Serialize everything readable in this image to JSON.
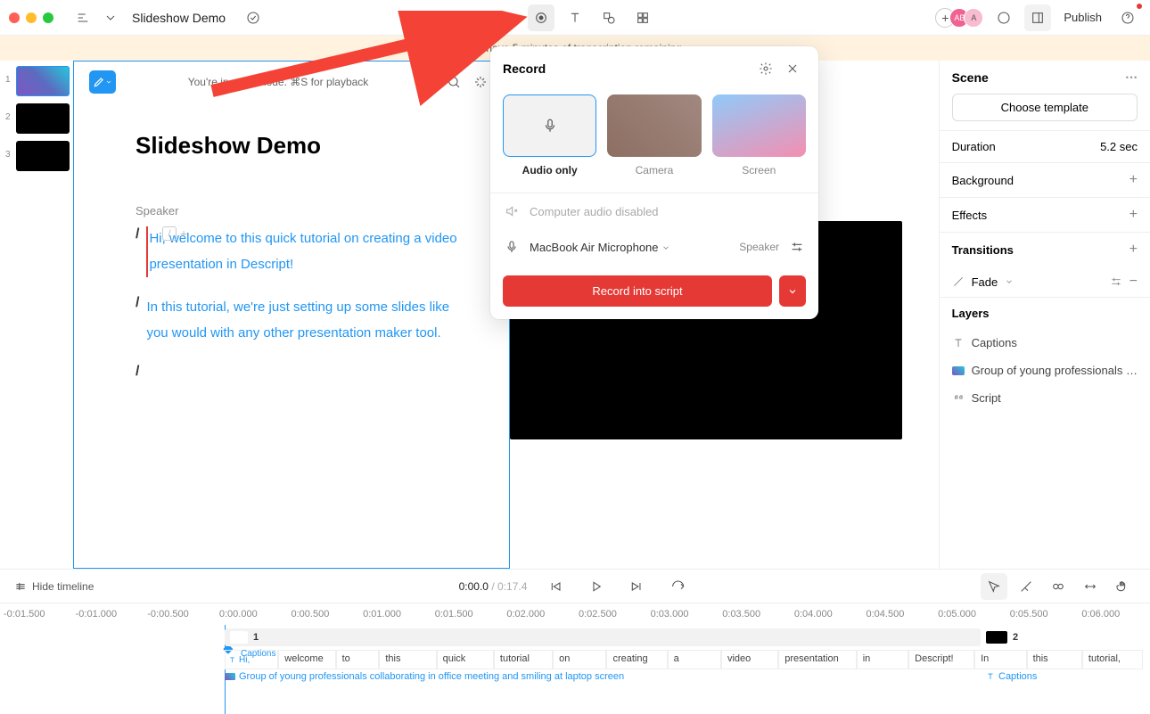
{
  "toolbar": {
    "doc_title": "Slideshow Demo",
    "publish_label": "Publish"
  },
  "banner": {
    "text": "You have 5 minutes of transcription remaining."
  },
  "slides": {
    "items": [
      {
        "num": "1"
      },
      {
        "num": "2"
      },
      {
        "num": "3"
      }
    ]
  },
  "editor": {
    "hint": "You're in write mode. ⌘S for playback",
    "title": "Slideshow Demo",
    "speaker_label": "Speaker",
    "p1": "Hi, welcome to this quick tutorial  on creating a video presentation in Descript!",
    "p2": "In this tutorial, we're just setting up some slides like you would with any other presentation maker tool."
  },
  "record_popover": {
    "title": "Record",
    "options": {
      "audio": "Audio only",
      "camera": "Camera",
      "screen": "Screen"
    },
    "computer_audio": "Computer audio disabled",
    "mic_device": "MacBook Air Microphone",
    "speaker_label": "Speaker",
    "button": "Record into script"
  },
  "right_panel": {
    "scene_title": "Scene",
    "choose_template": "Choose template",
    "duration_label": "Duration",
    "duration_value": "5.2 sec",
    "background_label": "Background",
    "effects_label": "Effects",
    "transitions_label": "Transitions",
    "transition_item": "Fade",
    "layers_label": "Layers",
    "layer_captions": "Captions",
    "layer_image": "Group of young professionals …",
    "layer_script": "Script"
  },
  "player": {
    "hide_timeline": "Hide timeline",
    "current": "0:00.0",
    "duration": "0:17.4"
  },
  "timeline": {
    "ticks": [
      "-0:01.500",
      "-0:01.000",
      "-0:00.500",
      "0:00.000",
      "0:00.500",
      "0:01.000",
      "0:01.500",
      "0:02.000",
      "0:02.500",
      "0:03.000",
      "0:03.500",
      "0:04.000",
      "0:04.500",
      "0:05.000",
      "0:05.500",
      "0:06.000"
    ],
    "scene1_label": "1",
    "scene2_label": "2",
    "captions_label": "Captions",
    "words": [
      "Hi,",
      "welcome",
      "to",
      "this",
      "quick",
      "tutorial",
      "on",
      "creating",
      "a",
      "video",
      "presentation",
      "in",
      "Descript!",
      "In",
      "this",
      "tutorial,"
    ],
    "clip_label": "Group of young professionals collaborating in office meeting and smiling at laptop screen",
    "captions2": "Captions"
  }
}
